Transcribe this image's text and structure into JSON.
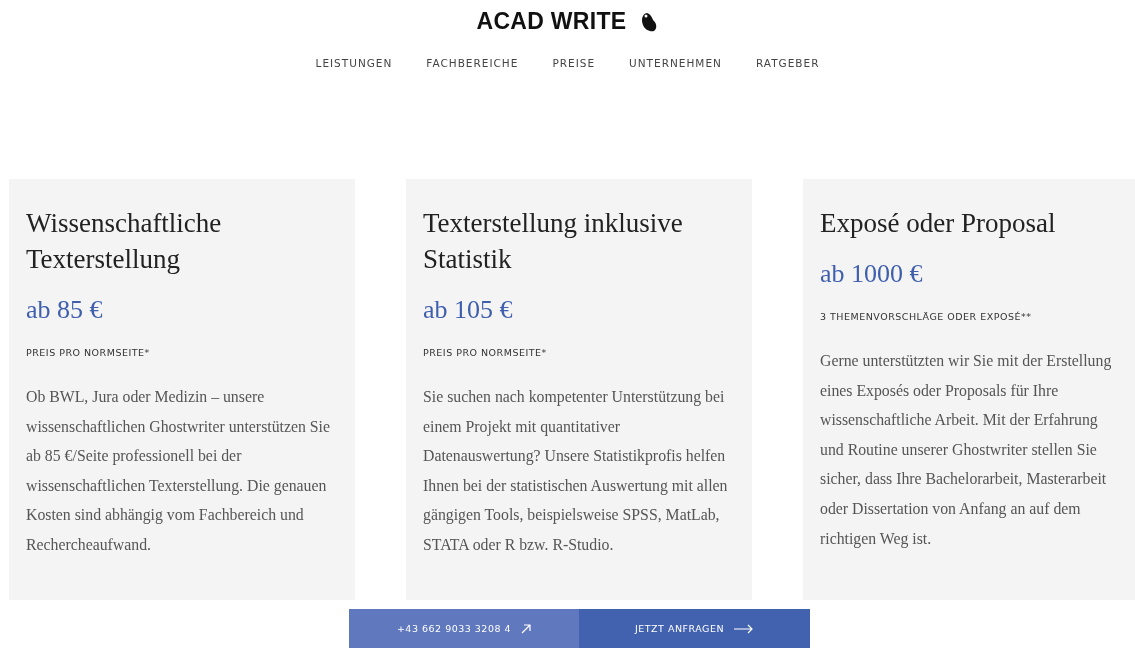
{
  "header": {
    "logo": "ACAD WRITE"
  },
  "nav": [
    {
      "label": "LEISTUNGEN"
    },
    {
      "label": "FACHBEREICHE"
    },
    {
      "label": "PREISE"
    },
    {
      "label": "UNTERNEHMEN"
    },
    {
      "label": "RATGEBER"
    }
  ],
  "cards": [
    {
      "title": "Wissenschaftliche Texterstellung",
      "price": "ab 85 €",
      "label": "PREIS PRO NORMSEITE*",
      "text": "Ob BWL, Jura oder Medizin – unsere wissenschaftlichen Ghostwriter unterstützen Sie ab 85 €/Seite professionell bei der wissenschaftlichen Texterstellung. Die genauen Kosten sind abhängig vom Fachbereich und Rechercheaufwand."
    },
    {
      "title": "Texterstellung inklusive Statistik",
      "price": "ab 105 €",
      "label": "PREIS PRO NORMSEITE*",
      "text": "Sie suchen nach kompetenter Unterstützung bei einem Projekt mit quantitativer Datenauswertung? Unsere Statistikprofis helfen Ihnen bei der statistischen Auswertung mit allen gängigen Tools, beispielsweise SPSS, MatLab, STATA oder R bzw. R-Studio."
    },
    {
      "title": "Exposé oder Proposal",
      "price": "ab 1000 €",
      "label": "3 THEMENVORSCHLÄGE ODER EXPOSÉ**",
      "text": "Gerne unterstützten wir Sie mit der Erstellung eines Exposés oder Proposals für Ihre wissenschaftliche Arbeit. Mit der Erfahrung und Routine unserer Ghostwriter stellen Sie sicher, dass Ihre Bachelorarbeit, Masterarbeit oder Dissertation von Anfang an auf dem richtigen Weg ist."
    }
  ],
  "cta": {
    "phone": "+43 662 9033 3208 4",
    "request": "JETZT ANFRAGEN"
  }
}
